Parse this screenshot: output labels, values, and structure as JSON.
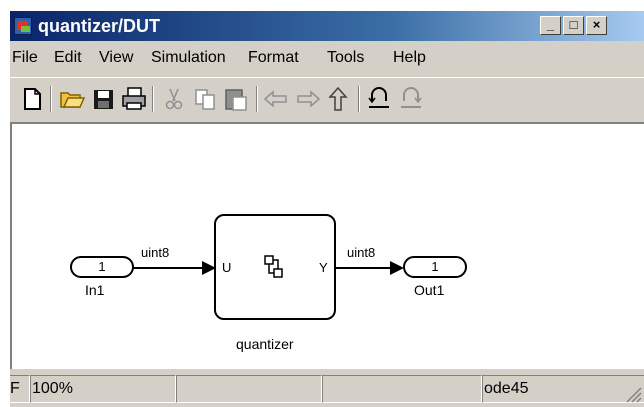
{
  "window": {
    "title": "quantizer/DUT",
    "minimize": "_",
    "maximize": "□",
    "close": "×"
  },
  "menu": [
    "File",
    "Edit",
    "View",
    "Simulation",
    "Format",
    "Tools",
    "Help"
  ],
  "toolbar": [
    "new-icon",
    "open-icon",
    "save-icon",
    "print-icon",
    "cut-icon",
    "copy-icon",
    "paste-icon",
    "back-icon",
    "forward-icon",
    "up-icon",
    "undo-icon",
    "redo-icon"
  ],
  "model": {
    "inport": {
      "number": "1",
      "name": "In1"
    },
    "outport": {
      "number": "1",
      "name": "Out1"
    },
    "subsystem": {
      "name": "quantizer",
      "in_label": "U",
      "out_label": "Y"
    },
    "signal_in": "uint8",
    "signal_out": "uint8"
  },
  "status": {
    "left": "F",
    "zoom": "100%",
    "solver": "ode45"
  }
}
